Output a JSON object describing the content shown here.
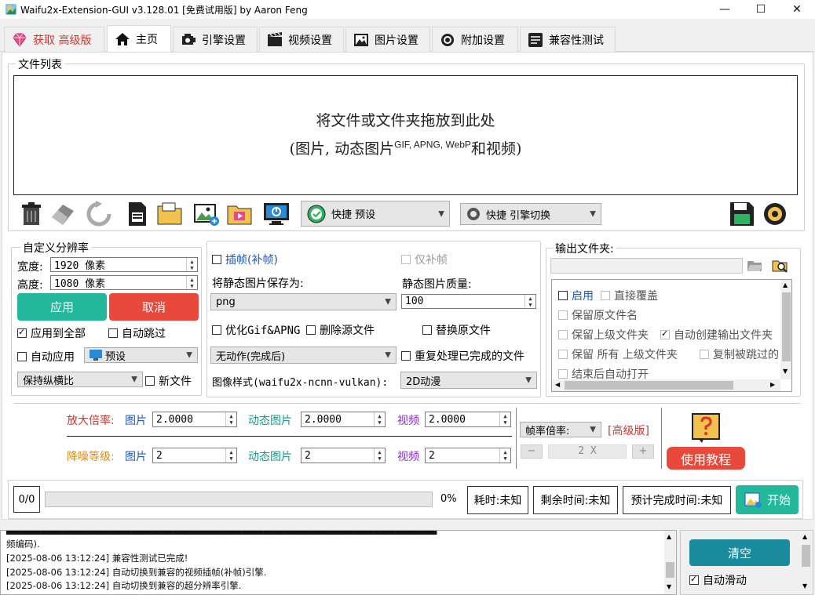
{
  "window": {
    "title": "Waifu2x-Extension-GUI v3.128.01 [免费试用版] by Aaron Feng",
    "minimize": "—",
    "maximize": "☐",
    "close": "✕"
  },
  "tabs": [
    {
      "label": "获取  高级版",
      "icon": "diamond-icon"
    },
    {
      "label": "主页",
      "icon": "home-icon"
    },
    {
      "label": "引擎设置",
      "icon": "engine-icon"
    },
    {
      "label": "视频设置",
      "icon": "film-icon"
    },
    {
      "label": "图片设置",
      "icon": "image-icon"
    },
    {
      "label": "附加设置",
      "icon": "gear-icon"
    },
    {
      "label": "兼容性测试",
      "icon": "checklist-icon"
    }
  ],
  "file_list": {
    "title": "文件列表",
    "drop_line1": "将文件或文件夹拖放到此处",
    "drop_line2_prefix": "(图片, 动态图片",
    "drop_line2_sup": "GIF, APNG, WebP",
    "drop_line2_suffix": "和视频)"
  },
  "toolbar": {
    "quick_preset": "快捷 预设",
    "quick_engine": "快捷 引擎切换"
  },
  "custom_res": {
    "title": "自定义分辨率",
    "width_label": "宽度:",
    "width_value": "1920 像素",
    "height_label": "高度:",
    "height_value": "1080 像素",
    "apply": "应用",
    "cancel": "取消",
    "apply_all": "应用到全部",
    "auto_skip": "自动跳过",
    "auto_apply": "自动应用",
    "preset": "预设",
    "aspect": "保持纵横比",
    "new_file": "新文件"
  },
  "middle": {
    "interp": "插帧(补帧)",
    "interp_only": "仅补帧",
    "save_static_as": "将静态图片保存为:",
    "static_quality": "静态图片质量:",
    "format": "png",
    "quality": "100",
    "optimize_gif": "优化Gif&APNG",
    "delete_source": "删除源文件",
    "replace_source": "替换原文件",
    "no_action": "无动作(完成后)",
    "reprocess": "重复处理已完成的文件",
    "image_style_label": "图像样式(waifu2x-ncnn-vulkan):",
    "image_style": "2D动漫"
  },
  "output": {
    "title": "输出文件夹:",
    "enable": "启用",
    "overwrite": "直接覆盖",
    "keep_name": "保留原文件名",
    "keep_parent": "保留上级文件夹",
    "auto_create": "自动创建输出文件夹",
    "keep_all": "保留  所有  上级文件夹",
    "copy_skipped": "复制被跳过的",
    "auto_open": "结束后自动打开"
  },
  "scale": {
    "label": "放大倍率:",
    "image_label": "图片",
    "image_value": "2.0000",
    "anim_label": "动态图片",
    "anim_value": "2.0000",
    "video_label": "视频",
    "video_value": "2.0000"
  },
  "denoise": {
    "label": "降噪等级:",
    "image_label": "图片",
    "image_value": "2",
    "anim_label": "动态图片",
    "anim_value": "2",
    "video_label": "视频",
    "video_value": "2"
  },
  "framerate": {
    "label": "帧率倍率:",
    "premium": "[高级版]",
    "minus": "−",
    "value": "2 X",
    "plus": "+"
  },
  "help": {
    "tutorial": "使用教程"
  },
  "progress": {
    "count": "0/0",
    "percent_value": 0,
    "percent_text": "0%",
    "elapsed": "耗时:未知",
    "remaining": "剩余时间:未知",
    "eta": "预计完成时间:未知",
    "start": "开始"
  },
  "log": {
    "lines": [
      "频编码).",
      "[2025-08-06 13:12:24] 兼容性测试已完成!",
      "[2025-08-06 13:12:24] 自动切换到兼容的视频插帧(补帧)引擎.",
      "[2025-08-06 13:12:24] 自动切换到兼容的超分辨率引擎."
    ],
    "clear": "清空",
    "auto_scroll": "自动滑动"
  },
  "colors": {
    "teal": "#23b89a",
    "red": "#e8493a",
    "blue_label": "#1c56c9",
    "teal_label": "#139c8a",
    "purple_label": "#8a2bd0",
    "red_label": "#d9342b",
    "orange_label": "#e08a18",
    "clear_btn": "#1a8a9d"
  }
}
